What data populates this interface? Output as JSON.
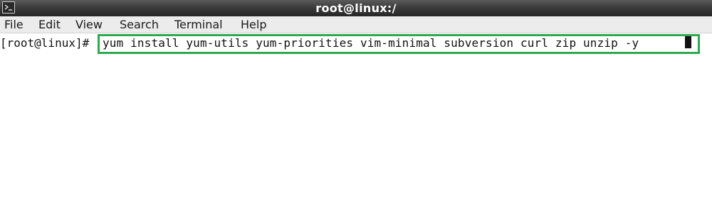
{
  "window": {
    "title": "root@linux:/",
    "icon": "terminal-icon"
  },
  "menubar": {
    "items": [
      "File",
      "Edit",
      "View",
      "Search",
      "Terminal",
      "Help"
    ]
  },
  "terminal": {
    "prompt": "[root@linux]#",
    "command": "yum install yum-utils yum-priorities vim-minimal subversion curl zip unzip -y"
  },
  "colors": {
    "titlebar": "#3c3c3c",
    "menubar_bg": "#ececec",
    "terminal_bg": "#ffffff",
    "terminal_text": "#111111",
    "highlight": "#2fa84f"
  }
}
